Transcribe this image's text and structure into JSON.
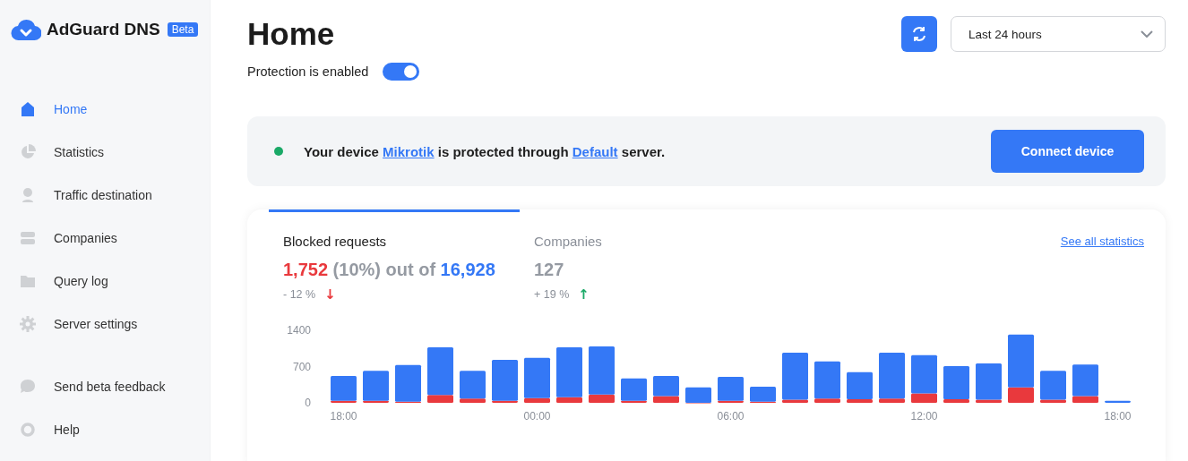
{
  "brand": {
    "name": "AdGuard DNS",
    "badge": "Beta"
  },
  "nav": [
    {
      "label": "Home",
      "selected": true
    },
    {
      "label": "Statistics",
      "selected": false
    },
    {
      "label": "Traffic destination",
      "selected": false
    },
    {
      "label": "Companies",
      "selected": false
    },
    {
      "label": "Query log",
      "selected": false
    },
    {
      "label": "Server settings",
      "selected": false
    }
  ],
  "nav_bottom": [
    {
      "label": "Send beta feedback",
      "selected": false
    },
    {
      "label": "Help",
      "selected": false
    }
  ],
  "page": {
    "title": "Home",
    "protection_label": "Protection is enabled",
    "protection_on": true,
    "period": "Last 24 hours"
  },
  "device_card": {
    "protected": true,
    "sentence": [
      {
        "kind": "text",
        "text": "Your device "
      },
      {
        "kind": "link",
        "text": "Mikrotik"
      },
      {
        "kind": "text",
        "text": " is protected through "
      },
      {
        "kind": "link",
        "text": "Default"
      },
      {
        "kind": "text",
        "text": " server."
      }
    ],
    "button": "Connect device"
  },
  "stats": {
    "link": "See all statistics",
    "tabs": [
      {
        "label": "Blocked requests",
        "selected": true,
        "kind": "ratio",
        "blocked": "1,752",
        "middle": "(10%) out of",
        "total": "16,928",
        "change": "- 12 %",
        "arrow": "↓",
        "color": "#e9393d"
      },
      {
        "label": "Companies",
        "selected": false,
        "kind": "count",
        "value": "127",
        "change": "+ 19 %",
        "arrow": "↑",
        "color": "#1aa967"
      }
    ],
    "chart_data": {
      "type": "bar",
      "stacked": true,
      "ylim": [
        0,
        1400
      ],
      "yticks": [
        0,
        700,
        1400
      ],
      "categories": [
        "18:00",
        null,
        null,
        null,
        null,
        null,
        "00:00",
        null,
        null,
        null,
        null,
        null,
        "06:00",
        null,
        null,
        null,
        null,
        null,
        "12:00",
        null,
        null,
        null,
        null,
        null,
        "18:00"
      ],
      "series": [
        {
          "color": "#e9393d",
          "values": [
            40,
            40,
            20,
            150,
            80,
            40,
            90,
            110,
            160,
            40,
            130,
            0,
            40,
            20,
            60,
            80,
            70,
            80,
            180,
            70,
            60,
            300,
            60,
            130,
            null
          ]
        },
        {
          "color": "#3478f6",
          "values": [
            480,
            580,
            710,
            920,
            540,
            790,
            780,
            960,
            930,
            430,
            390,
            300,
            460,
            290,
            910,
            720,
            520,
            890,
            740,
            640,
            700,
            1020,
            560,
            610,
            40
          ]
        }
      ]
    }
  }
}
